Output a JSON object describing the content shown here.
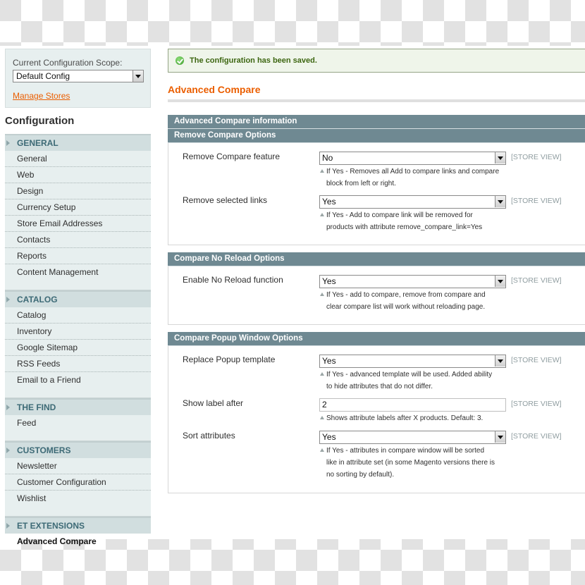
{
  "sidebar": {
    "scope_label": "Current Configuration Scope:",
    "scope_value": "Default Config",
    "manage_stores": "Manage Stores",
    "config_title": "Configuration",
    "groups": [
      {
        "title": "GENERAL",
        "items": [
          "General",
          "Web",
          "Design",
          "Currency Setup",
          "Store Email Addresses",
          "Contacts",
          "Reports",
          "Content Management"
        ]
      },
      {
        "title": "CATALOG",
        "items": [
          "Catalog",
          "Inventory",
          "Google Sitemap",
          "RSS Feeds",
          "Email to a Friend"
        ]
      },
      {
        "title": "THE FIND",
        "items": [
          "Feed"
        ]
      },
      {
        "title": "CUSTOMERS",
        "items": [
          "Newsletter",
          "Customer Configuration",
          "Wishlist"
        ]
      },
      {
        "title": "ET EXTENSIONS",
        "items": []
      }
    ],
    "active_item": "Advanced Compare"
  },
  "main": {
    "message": "The configuration has been saved.",
    "page_title": "Advanced Compare",
    "info_header": "Advanced Compare information",
    "sections": [
      {
        "title": "Remove Compare Options",
        "rows": [
          {
            "label": "Remove Compare feature",
            "type": "select",
            "value": "No",
            "scope": "[STORE VIEW]",
            "note": [
              "If Yes - Removes all Add to compare links and compare",
              "block from left or right."
            ]
          },
          {
            "label": "Remove selected links",
            "type": "select",
            "value": "Yes",
            "scope": "[STORE VIEW]",
            "note": [
              "If Yes - Add to compare link will be removed for",
              "products with attribute remove_compare_link=Yes"
            ]
          }
        ]
      },
      {
        "title": "Compare No Reload Options",
        "rows": [
          {
            "label": "Enable No Reload function",
            "type": "select",
            "value": "Yes",
            "scope": "[STORE VIEW]",
            "note": [
              "If Yes - add to compare, remove from compare and",
              "clear compare list will work without reloading page."
            ]
          }
        ]
      },
      {
        "title": "Compare Popup Window Options",
        "rows": [
          {
            "label": "Replace Popup template",
            "type": "select",
            "value": "Yes",
            "scope": "[STORE VIEW]",
            "note": [
              "If Yes - advanced template will be used. Added ability",
              "to hide attributes that do not differ."
            ]
          },
          {
            "label": "Show label after",
            "type": "text",
            "value": "2",
            "scope": "[STORE VIEW]",
            "note": [
              "Shows attribute labels after X products. Default: 3."
            ]
          },
          {
            "label": "Sort attributes",
            "type": "select",
            "value": "Yes",
            "scope": "[STORE VIEW]",
            "note": [
              "If Yes - attributes in compare window will be sorted",
              "like in attribute set (in some Magento versions there is",
              "no sorting by default)."
            ]
          }
        ]
      }
    ]
  }
}
